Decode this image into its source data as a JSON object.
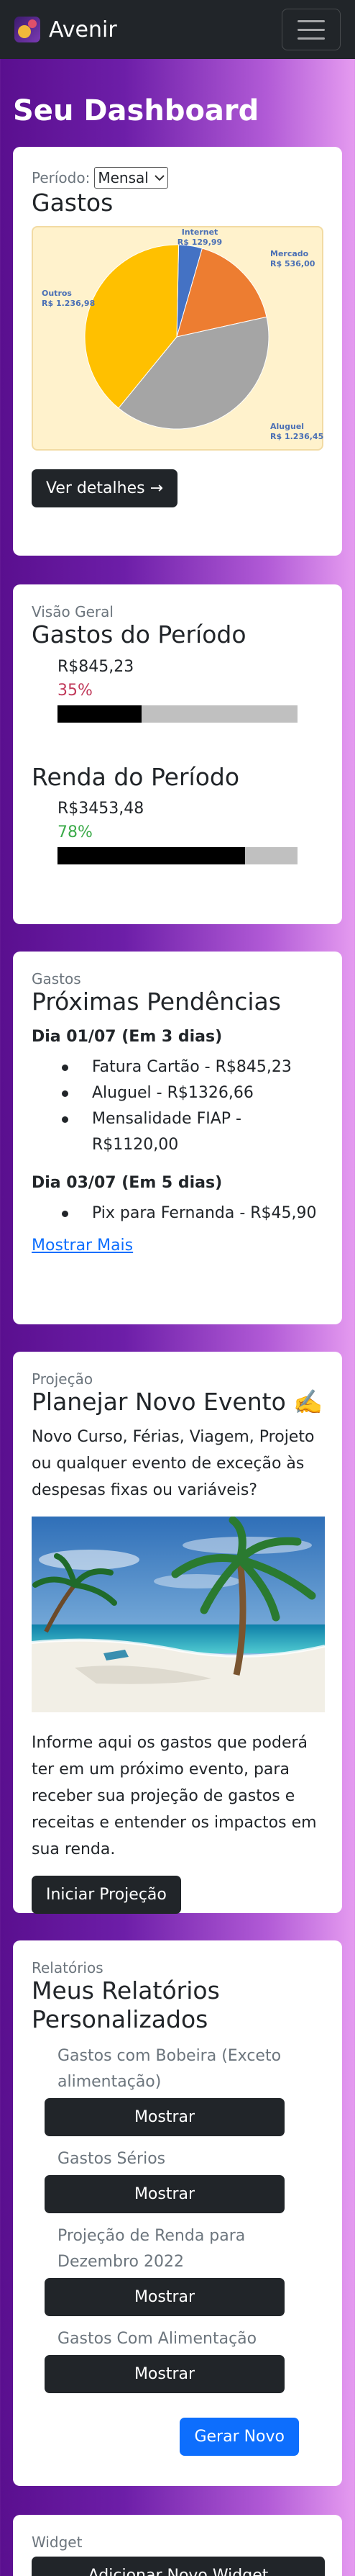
{
  "navbar": {
    "brand": "Avenir",
    "menu_icon": "hamburger-icon"
  },
  "page": {
    "title": "Seu Dashboard"
  },
  "gastos_card": {
    "period_label": "Período:",
    "period_selected": "Mensal",
    "title": "Gastos",
    "details_button": "Ver detalhes →"
  },
  "chart_data": {
    "type": "pie",
    "slices": [
      {
        "label": "Internet",
        "value_label": "R$ 129,99",
        "value": 129.99,
        "color": "#4472c4"
      },
      {
        "label": "Mercado",
        "value_label": "R$ 536,00",
        "value": 536.0,
        "color": "#ed7d31"
      },
      {
        "label": "Aluguel",
        "value_label": "R$ 1.236,45",
        "value": 1236.45,
        "color": "#a5a5a5"
      },
      {
        "label": "Outros",
        "value_label": "R$ 1.236,98",
        "value": 1236.98,
        "color": "#ffc000"
      }
    ]
  },
  "visao_card": {
    "subtitle": "Visão Geral",
    "gastos_title": "Gastos do Período",
    "gastos_value": "R$845,23",
    "gastos_pct_label": "35%",
    "gastos_pct": 0.35,
    "gastos_pct_color": "#c0395a",
    "renda_title": "Renda do Período",
    "renda_value": "R$3453,48",
    "renda_pct_label": "78%",
    "renda_pct": 0.78,
    "renda_pct_color": "#3cab4a"
  },
  "pendencias_card": {
    "subtitle": "Gastos",
    "title": "Próximas Pendências",
    "days": [
      {
        "heading": "Dia 01/07 (Em 3 dias)",
        "items": [
          "Fatura Cartão - R$845,23",
          "Aluguel - R$1326,66",
          "Mensalidade FIAP - R$1120,00"
        ]
      },
      {
        "heading": "Dia 03/07 (Em 5 dias)",
        "items": [
          "Pix para Fernanda - R$45,90"
        ]
      }
    ],
    "more_link": "Mostrar Mais"
  },
  "projecao_card": {
    "subtitle": "Projeção",
    "title": "Planejar Novo Evento ✍️",
    "intro": "Novo Curso, Férias, Viagem, Projeto ou qualquer evento de exceção às despesas fixas ou variáveis?",
    "body": "Informe aqui os gastos que poderá ter em um próximo evento, para receber sua projeção de gastos e receitas e entender os impactos em sua renda.",
    "button": "Iniciar Projeção"
  },
  "relatorios_card": {
    "subtitle": "Relatórios",
    "title": "Meus Relatórios Personalizados",
    "reports": [
      {
        "label": "Gastos com Bobeira (Exceto alimentação)",
        "button": "Mostrar"
      },
      {
        "label": "Gastos Sérios",
        "button": "Mostrar"
      },
      {
        "label": "Projeção de Renda para Dezembro 2022",
        "button": "Mostrar"
      },
      {
        "label": "Gastos Com Alimentação",
        "button": "Mostrar"
      }
    ],
    "new_button": "Gerar Novo"
  },
  "widget_card": {
    "subtitle": "Widget",
    "button": "Adicionar Novo Widget"
  }
}
